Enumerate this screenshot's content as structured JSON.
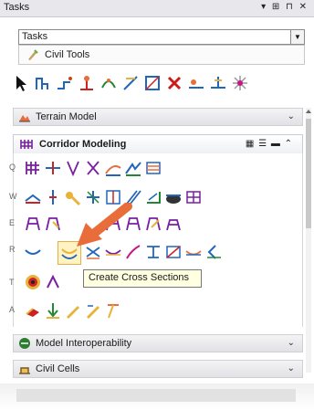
{
  "window": {
    "title": "Tasks",
    "controls": "▾ ⊞ ⊓ ✕"
  },
  "task_selector": {
    "value": "Tasks",
    "dropdown_glyph": "▼"
  },
  "breadcrumb": {
    "label": "Civil Tools"
  },
  "panels": {
    "terrain": {
      "label": "Terrain Model",
      "chevron": "⌄"
    },
    "corridor": {
      "label": "Corridor Modeling",
      "views_glyph": "▦ ☰ ▬ ⌃"
    },
    "model_interop": {
      "label": "Model Interoperability",
      "chevron": "⌄"
    },
    "civil_cells": {
      "label": "Civil Cells",
      "chevron": "⌄"
    }
  },
  "row_keys": [
    "Q",
    "W",
    "E",
    "R",
    "T",
    "A"
  ],
  "tooltip": {
    "text": "Create Cross Sections"
  },
  "colors": {
    "accent_orange": "#e86d3a",
    "highlight": "#fff3c4"
  }
}
